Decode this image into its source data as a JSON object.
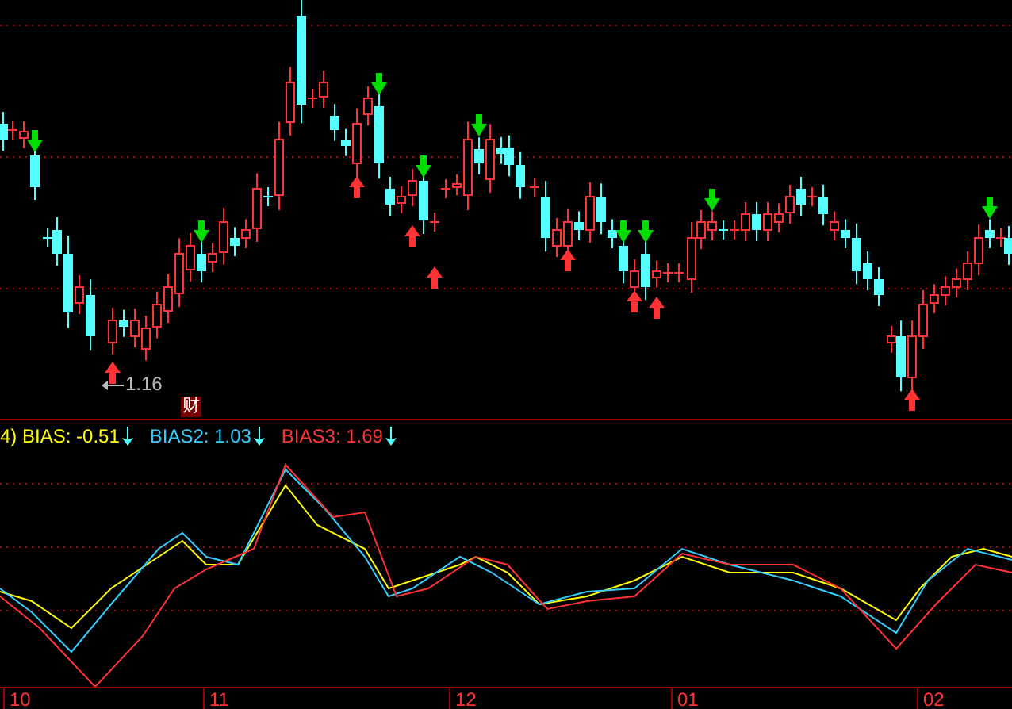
{
  "main_chart": {
    "low_marker": {
      "value": "1.16"
    },
    "badge": "财"
  },
  "indicator": {
    "legend": [
      {
        "label": "4) BIAS: -0.51",
        "color": "#ffff00",
        "falling": true
      },
      {
        "label": "BIAS2: 1.03",
        "color": "#33ccff",
        "falling": true
      },
      {
        "label": "BIAS3: 1.69",
        "color": "#ff3333",
        "falling": true
      }
    ]
  },
  "x_axis": {
    "labels": [
      "10",
      "11",
      "12",
      "01",
      "02"
    ]
  }
}
